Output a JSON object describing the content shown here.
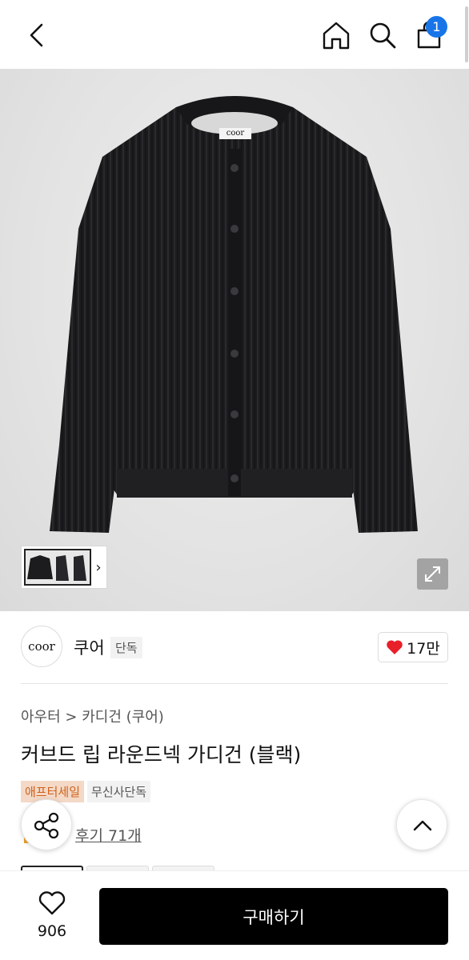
{
  "header": {
    "back_icon": "chevron-left-icon",
    "home_icon": "home-icon",
    "search_icon": "search-icon",
    "cart_icon": "shopping-bag-icon",
    "cart_count": "1",
    "badge_color": "#1875e8"
  },
  "gallery": {
    "thumbnail_arrow": "›",
    "expand_icon": "expand-icon",
    "garment_label": "coor"
  },
  "brand": {
    "logo_text": "coor",
    "name": "쿠어",
    "tag": "단독",
    "likes": "17만",
    "like_color": "#e8202a"
  },
  "product": {
    "breadcrumb": "아우터 > 카디건 (쿠어)",
    "title": "커브드 립 라운드넥 가디건 (블랙)",
    "tags": [
      "애프터세일",
      "무신사단독"
    ],
    "review_link": "후기 71개"
  },
  "floating": {
    "share_icon": "share-icon",
    "scroll_top_icon": "chevron-up-icon"
  },
  "bottom_bar": {
    "wish_icon": "heart-outline-icon",
    "wish_count": "906",
    "buy_label": "구매하기"
  }
}
